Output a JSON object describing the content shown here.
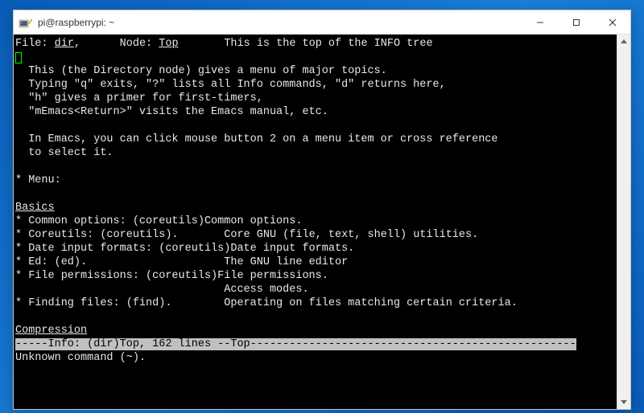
{
  "window": {
    "title": "pi@raspberrypi: ~"
  },
  "header": {
    "file_label": "File:",
    "file_value": "dir",
    "node_label": "Node:",
    "node_value": "Top",
    "desc": "This is the top of the INFO tree"
  },
  "intro": {
    "l1": "  This (the Directory node) gives a menu of major topics.",
    "l2": "  Typing \"q\" exits, \"?\" lists all Info commands, \"d\" returns here,",
    "l3": "  \"h\" gives a primer for first-timers,",
    "l4": "  \"mEmacs<Return>\" visits the Emacs manual, etc.",
    "l5": "  In Emacs, you can click mouse button 2 on a menu item or cross reference",
    "l6": "  to select it."
  },
  "menu_label": "* Menu:",
  "sections": {
    "basics": {
      "title": "Basics",
      "items": [
        {
          "entry": "Common options",
          "target": "(coreutils)Common options",
          "desc": ""
        },
        {
          "entry": "Coreutils",
          "target": "(coreutils)",
          "desc": "Core GNU (file, text, shell) utilities."
        },
        {
          "entry": "Date input formats",
          "target": "(coreutils)Date input formats",
          "desc": ""
        },
        {
          "entry": "Ed",
          "target": "(ed)",
          "desc": "The GNU line editor"
        },
        {
          "entry": "File permissions",
          "target": "(coreutils)File permissions",
          "desc": "",
          "desc2": "Access modes."
        },
        {
          "entry": "",
          "target": "",
          "desc": ""
        },
        {
          "entry": "Finding files",
          "target": "(find)",
          "desc": "Operating on files matching certain criteria."
        }
      ]
    },
    "compression": {
      "title": "Compression"
    }
  },
  "lines": {
    "b0": "* Common options: (coreutils)Common options.",
    "b1_a": "* Coreutils: (coreutils).",
    "b1_b": "       Core GNU (file, text, shell) utilities.",
    "b2": "* Date input formats: (coreutils)Date input formats.",
    "b3_a": "* Ed: (ed).",
    "b3_b": "                     The GNU line editor",
    "b4": "* File permissions: (coreutils)File permissions.",
    "b4s": "                                Access modes.",
    "b5_a": "* Finding files: (find).",
    "b5_b": "        Operating on files matching certain criteria."
  },
  "statusline": {
    "left": "-----Info: (dir)Top, 162 lines --Top",
    "fill": "--------------------------------------------------"
  },
  "cmdline": "Unknown command (~)."
}
